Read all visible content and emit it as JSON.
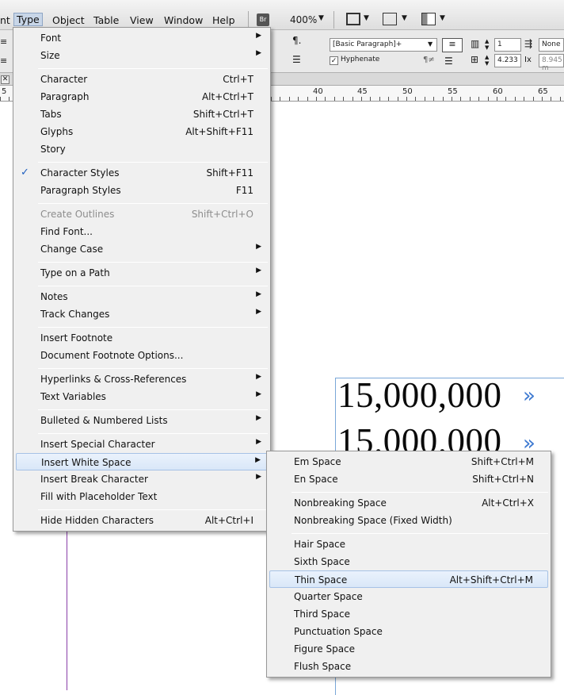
{
  "menubar": {
    "items": [
      {
        "label": "nt"
      },
      {
        "label": "Type"
      },
      {
        "label": "Object"
      },
      {
        "label": "Table"
      },
      {
        "label": "View"
      },
      {
        "label": "Window"
      },
      {
        "label": "Help"
      }
    ],
    "bridge_label": "Br",
    "zoom": "400%"
  },
  "control_panel": {
    "paragraph_style": "[Basic Paragraph]+",
    "hyphenate_label": "Hyphenate",
    "columns_value": "1",
    "gutter_value": "4.233",
    "none_label": "None",
    "offset_value": "8.945 m"
  },
  "ruler": {
    "labels": [
      "5",
      "40",
      "45",
      "50",
      "55",
      "60",
      "65"
    ]
  },
  "document": {
    "line1": "15,000,000",
    "line2": "15.000.000",
    "overflow_glyph": "»"
  },
  "type_menu": {
    "items": [
      {
        "label": "Font",
        "shortcut": "",
        "sub": true
      },
      {
        "label": "Size",
        "shortcut": "",
        "sub": true
      },
      {
        "label": "Character",
        "shortcut": "Ctrl+T"
      },
      {
        "label": "Paragraph",
        "shortcut": "Alt+Ctrl+T"
      },
      {
        "label": "Tabs",
        "shortcut": "Shift+Ctrl+T"
      },
      {
        "label": "Glyphs",
        "shortcut": "Alt+Shift+F11"
      },
      {
        "label": "Story",
        "shortcut": ""
      },
      {
        "label": "Character Styles",
        "shortcut": "Shift+F11",
        "checked": true
      },
      {
        "label": "Paragraph Styles",
        "shortcut": "F11"
      },
      {
        "label": "Create Outlines",
        "shortcut": "Shift+Ctrl+O",
        "disabled": true
      },
      {
        "label": "Find Font...",
        "shortcut": ""
      },
      {
        "label": "Change Case",
        "shortcut": "",
        "sub": true
      },
      {
        "label": "Type on a Path",
        "shortcut": "",
        "sub": true
      },
      {
        "label": "Notes",
        "shortcut": "",
        "sub": true
      },
      {
        "label": "Track Changes",
        "shortcut": "",
        "sub": true
      },
      {
        "label": "Insert Footnote",
        "shortcut": ""
      },
      {
        "label": "Document Footnote Options...",
        "shortcut": ""
      },
      {
        "label": "Hyperlinks & Cross-References",
        "shortcut": "",
        "sub": true
      },
      {
        "label": "Text Variables",
        "shortcut": "",
        "sub": true
      },
      {
        "label": "Bulleted & Numbered Lists",
        "shortcut": "",
        "sub": true
      },
      {
        "label": "Insert Special Character",
        "shortcut": "",
        "sub": true
      },
      {
        "label": "Insert White Space",
        "shortcut": "",
        "sub": true,
        "highlighted": true
      },
      {
        "label": "Insert Break Character",
        "shortcut": "",
        "sub": true
      },
      {
        "label": "Fill with Placeholder Text",
        "shortcut": ""
      },
      {
        "label": "Hide Hidden Characters",
        "shortcut": "Alt+Ctrl+I"
      }
    ]
  },
  "white_space_menu": {
    "items": [
      {
        "label": "Em Space",
        "shortcut": "Shift+Ctrl+M"
      },
      {
        "label": "En Space",
        "shortcut": "Shift+Ctrl+N"
      },
      {
        "label": "Nonbreaking Space",
        "shortcut": "Alt+Ctrl+X"
      },
      {
        "label": "Nonbreaking Space (Fixed Width)",
        "shortcut": ""
      },
      {
        "label": "Hair Space",
        "shortcut": ""
      },
      {
        "label": "Sixth Space",
        "shortcut": ""
      },
      {
        "label": "Thin Space",
        "shortcut": "Alt+Shift+Ctrl+M",
        "highlighted": true
      },
      {
        "label": "Quarter Space",
        "shortcut": ""
      },
      {
        "label": "Third Space",
        "shortcut": ""
      },
      {
        "label": "Punctuation Space",
        "shortcut": ""
      },
      {
        "label": "Figure Space",
        "shortcut": ""
      },
      {
        "label": "Flush Space",
        "shortcut": ""
      }
    ]
  }
}
